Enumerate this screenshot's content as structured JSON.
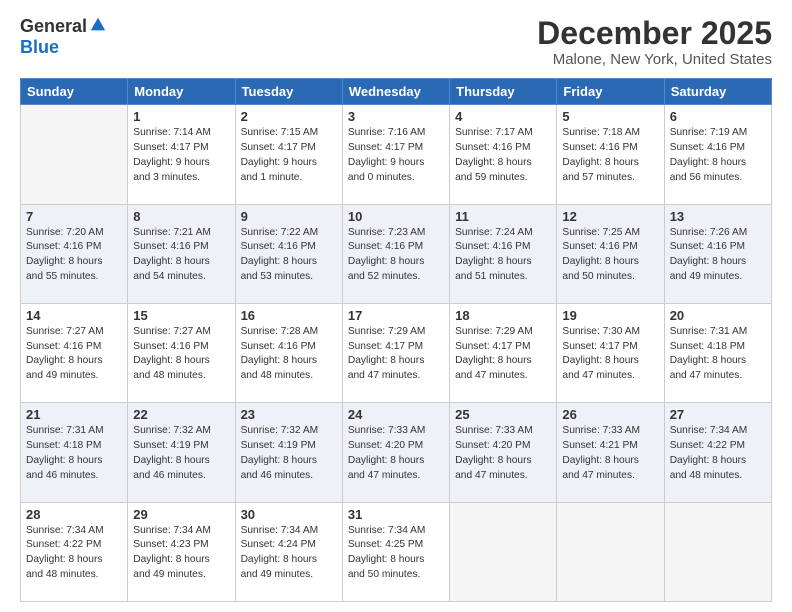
{
  "logo": {
    "general": "General",
    "blue": "Blue"
  },
  "title": "December 2025",
  "location": "Malone, New York, United States",
  "headers": [
    "Sunday",
    "Monday",
    "Tuesday",
    "Wednesday",
    "Thursday",
    "Friday",
    "Saturday"
  ],
  "weeks": [
    [
      {
        "day": "",
        "lines": []
      },
      {
        "day": "1",
        "lines": [
          "Sunrise: 7:14 AM",
          "Sunset: 4:17 PM",
          "Daylight: 9 hours",
          "and 3 minutes."
        ]
      },
      {
        "day": "2",
        "lines": [
          "Sunrise: 7:15 AM",
          "Sunset: 4:17 PM",
          "Daylight: 9 hours",
          "and 1 minute."
        ]
      },
      {
        "day": "3",
        "lines": [
          "Sunrise: 7:16 AM",
          "Sunset: 4:17 PM",
          "Daylight: 9 hours",
          "and 0 minutes."
        ]
      },
      {
        "day": "4",
        "lines": [
          "Sunrise: 7:17 AM",
          "Sunset: 4:16 PM",
          "Daylight: 8 hours",
          "and 59 minutes."
        ]
      },
      {
        "day": "5",
        "lines": [
          "Sunrise: 7:18 AM",
          "Sunset: 4:16 PM",
          "Daylight: 8 hours",
          "and 57 minutes."
        ]
      },
      {
        "day": "6",
        "lines": [
          "Sunrise: 7:19 AM",
          "Sunset: 4:16 PM",
          "Daylight: 8 hours",
          "and 56 minutes."
        ]
      }
    ],
    [
      {
        "day": "7",
        "lines": [
          "Sunrise: 7:20 AM",
          "Sunset: 4:16 PM",
          "Daylight: 8 hours",
          "and 55 minutes."
        ]
      },
      {
        "day": "8",
        "lines": [
          "Sunrise: 7:21 AM",
          "Sunset: 4:16 PM",
          "Daylight: 8 hours",
          "and 54 minutes."
        ]
      },
      {
        "day": "9",
        "lines": [
          "Sunrise: 7:22 AM",
          "Sunset: 4:16 PM",
          "Daylight: 8 hours",
          "and 53 minutes."
        ]
      },
      {
        "day": "10",
        "lines": [
          "Sunrise: 7:23 AM",
          "Sunset: 4:16 PM",
          "Daylight: 8 hours",
          "and 52 minutes."
        ]
      },
      {
        "day": "11",
        "lines": [
          "Sunrise: 7:24 AM",
          "Sunset: 4:16 PM",
          "Daylight: 8 hours",
          "and 51 minutes."
        ]
      },
      {
        "day": "12",
        "lines": [
          "Sunrise: 7:25 AM",
          "Sunset: 4:16 PM",
          "Daylight: 8 hours",
          "and 50 minutes."
        ]
      },
      {
        "day": "13",
        "lines": [
          "Sunrise: 7:26 AM",
          "Sunset: 4:16 PM",
          "Daylight: 8 hours",
          "and 49 minutes."
        ]
      }
    ],
    [
      {
        "day": "14",
        "lines": [
          "Sunrise: 7:27 AM",
          "Sunset: 4:16 PM",
          "Daylight: 8 hours",
          "and 49 minutes."
        ]
      },
      {
        "day": "15",
        "lines": [
          "Sunrise: 7:27 AM",
          "Sunset: 4:16 PM",
          "Daylight: 8 hours",
          "and 48 minutes."
        ]
      },
      {
        "day": "16",
        "lines": [
          "Sunrise: 7:28 AM",
          "Sunset: 4:16 PM",
          "Daylight: 8 hours",
          "and 48 minutes."
        ]
      },
      {
        "day": "17",
        "lines": [
          "Sunrise: 7:29 AM",
          "Sunset: 4:17 PM",
          "Daylight: 8 hours",
          "and 47 minutes."
        ]
      },
      {
        "day": "18",
        "lines": [
          "Sunrise: 7:29 AM",
          "Sunset: 4:17 PM",
          "Daylight: 8 hours",
          "and 47 minutes."
        ]
      },
      {
        "day": "19",
        "lines": [
          "Sunrise: 7:30 AM",
          "Sunset: 4:17 PM",
          "Daylight: 8 hours",
          "and 47 minutes."
        ]
      },
      {
        "day": "20",
        "lines": [
          "Sunrise: 7:31 AM",
          "Sunset: 4:18 PM",
          "Daylight: 8 hours",
          "and 47 minutes."
        ]
      }
    ],
    [
      {
        "day": "21",
        "lines": [
          "Sunrise: 7:31 AM",
          "Sunset: 4:18 PM",
          "Daylight: 8 hours",
          "and 46 minutes."
        ]
      },
      {
        "day": "22",
        "lines": [
          "Sunrise: 7:32 AM",
          "Sunset: 4:19 PM",
          "Daylight: 8 hours",
          "and 46 minutes."
        ]
      },
      {
        "day": "23",
        "lines": [
          "Sunrise: 7:32 AM",
          "Sunset: 4:19 PM",
          "Daylight: 8 hours",
          "and 46 minutes."
        ]
      },
      {
        "day": "24",
        "lines": [
          "Sunrise: 7:33 AM",
          "Sunset: 4:20 PM",
          "Daylight: 8 hours",
          "and 47 minutes."
        ]
      },
      {
        "day": "25",
        "lines": [
          "Sunrise: 7:33 AM",
          "Sunset: 4:20 PM",
          "Daylight: 8 hours",
          "and 47 minutes."
        ]
      },
      {
        "day": "26",
        "lines": [
          "Sunrise: 7:33 AM",
          "Sunset: 4:21 PM",
          "Daylight: 8 hours",
          "and 47 minutes."
        ]
      },
      {
        "day": "27",
        "lines": [
          "Sunrise: 7:34 AM",
          "Sunset: 4:22 PM",
          "Daylight: 8 hours",
          "and 48 minutes."
        ]
      }
    ],
    [
      {
        "day": "28",
        "lines": [
          "Sunrise: 7:34 AM",
          "Sunset: 4:22 PM",
          "Daylight: 8 hours",
          "and 48 minutes."
        ]
      },
      {
        "day": "29",
        "lines": [
          "Sunrise: 7:34 AM",
          "Sunset: 4:23 PM",
          "Daylight: 8 hours",
          "and 49 minutes."
        ]
      },
      {
        "day": "30",
        "lines": [
          "Sunrise: 7:34 AM",
          "Sunset: 4:24 PM",
          "Daylight: 8 hours",
          "and 49 minutes."
        ]
      },
      {
        "day": "31",
        "lines": [
          "Sunrise: 7:34 AM",
          "Sunset: 4:25 PM",
          "Daylight: 8 hours",
          "and 50 minutes."
        ]
      },
      {
        "day": "",
        "lines": []
      },
      {
        "day": "",
        "lines": []
      },
      {
        "day": "",
        "lines": []
      }
    ]
  ]
}
